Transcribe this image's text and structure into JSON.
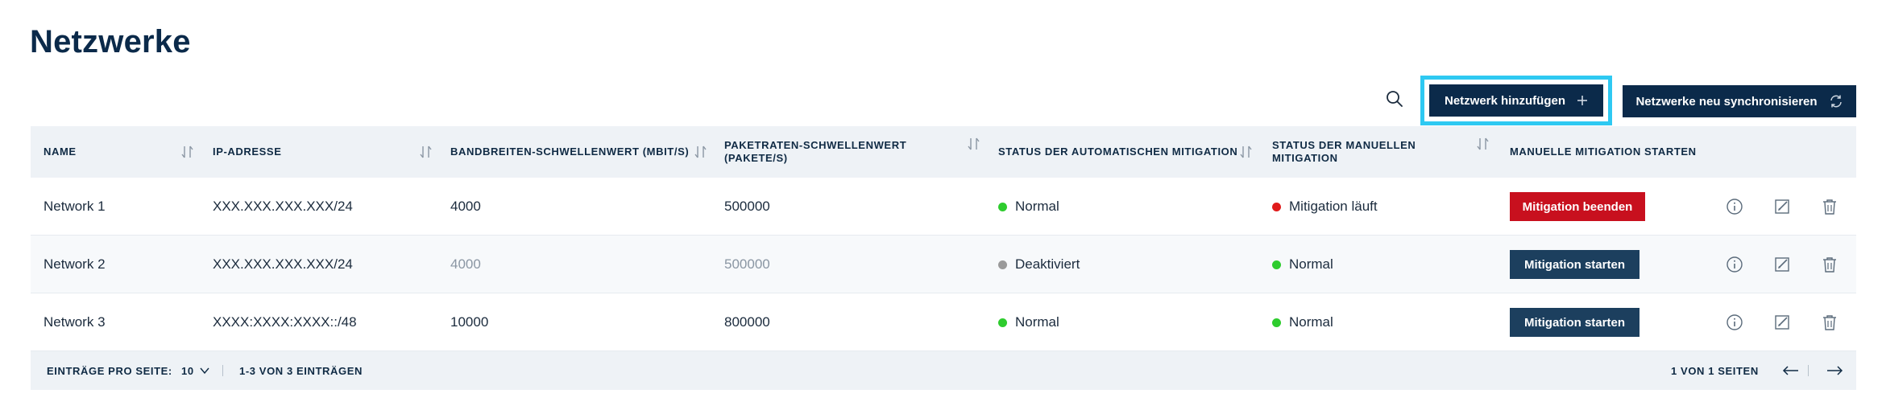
{
  "page": {
    "title": "Netzwerke"
  },
  "toolbar": {
    "add_label": "Netzwerk hinzufügen",
    "sync_label": "Netzwerke neu synchronisieren",
    "search_icon": "search-icon",
    "add_icon": "plus-icon",
    "sync_icon": "refresh-icon"
  },
  "table": {
    "headers": [
      "Name",
      "IP-Adresse",
      "Bandbreiten-Schwellenwert (MBit/s)",
      "Paketraten-Schwellenwert (Pakete/s)",
      "Status der automatischen Mitigation",
      "Status der manuellen Mitigation",
      "Manuelle Mitigation starten"
    ],
    "rows": [
      {
        "name": "Network 1",
        "ip": "XXX.XXX.XXX.XXX/24",
        "bandwidth": "4000",
        "packets": "500000",
        "auto_status": "Normal",
        "auto_color": "#2ecc2e",
        "manual_status": "Mitigation läuft",
        "manual_color": "#e01b1b",
        "action": "Mitigation beenden"
      },
      {
        "name": "Network 2",
        "ip": "XXX.XXX.XXX.XXX/24",
        "bandwidth": "4000",
        "packets": "500000",
        "auto_status": "Deaktiviert",
        "auto_color": "#9a9a9a",
        "manual_status": "Normal",
        "manual_color": "#2ecc2e",
        "action": "Mitigation starten"
      },
      {
        "name": "Network 3",
        "ip": "XXXX:XXXX:XXXX::/48",
        "bandwidth": "10000",
        "packets": "800000",
        "auto_status": "Normal",
        "auto_color": "#2ecc2e",
        "manual_status": "Normal",
        "manual_color": "#2ecc2e",
        "action": "Mitigation starten"
      }
    ],
    "row_icons": [
      "info-icon",
      "edit-icon",
      "trash-icon"
    ]
  },
  "footer": {
    "per_page_label": "Einträge pro Seite:",
    "per_page_value": "10",
    "range_text": "1-3 von 3 Einträgen",
    "page_text": "1 von 1 Seiten"
  },
  "colors": {
    "brand": "#0b2a4a",
    "highlight": "#2ec9f2",
    "danger": "#c8101e",
    "ok": "#2ecc2e"
  }
}
